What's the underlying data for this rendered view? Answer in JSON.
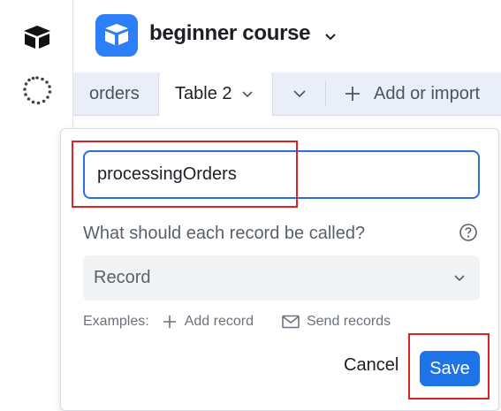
{
  "header": {
    "base_name": "beginner course",
    "logo_icon": "airtable-logo-icon",
    "accent_color": "#2d7ff9"
  },
  "tabs": [
    {
      "label": "orders",
      "active": false
    },
    {
      "label": "Table 2",
      "active": true
    }
  ],
  "tabbar": {
    "add_label": "Add or import"
  },
  "dialog": {
    "table_name_value": "processingOrders",
    "record_question": "What should each record be called?",
    "record_select_value": "Record",
    "examples_label": "Examples:",
    "example_add": "Add record",
    "example_send": "Send records",
    "cancel_label": "Cancel",
    "save_label": "Save"
  },
  "colors": {
    "primary_button": "#1d73e8",
    "highlight_outline": "#d92426",
    "tabbar_bg": "#e9eef8"
  }
}
